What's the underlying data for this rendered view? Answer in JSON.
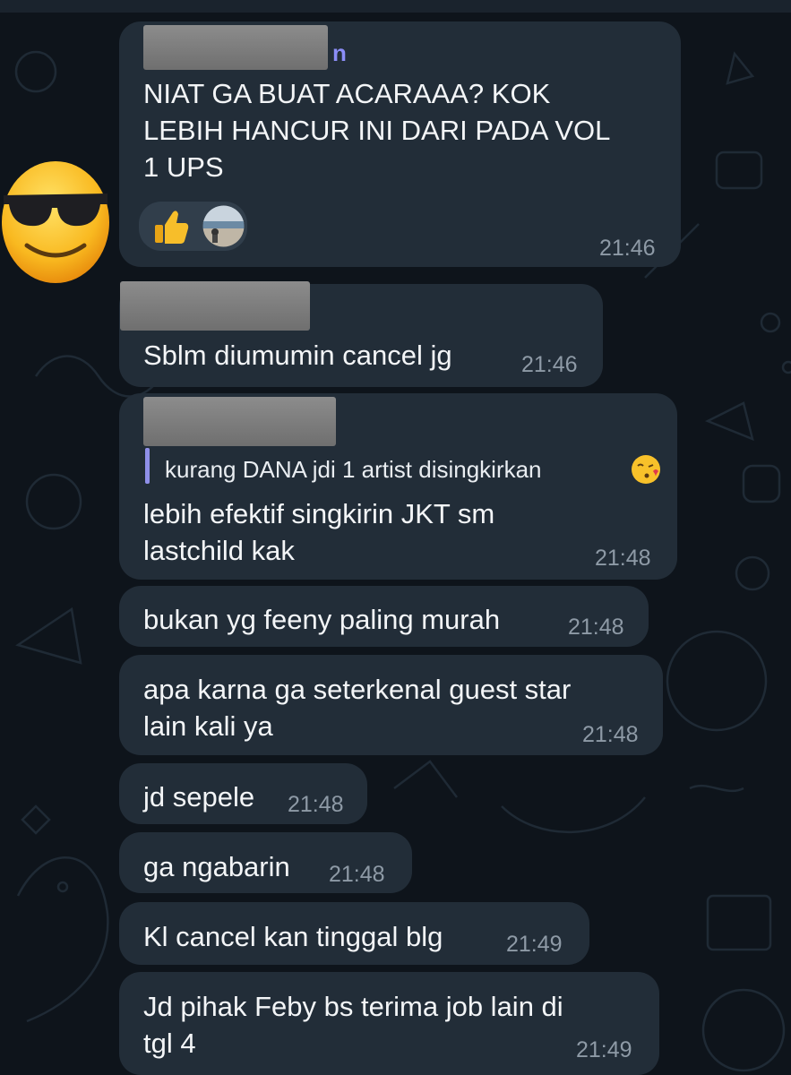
{
  "messages": [
    {
      "sender_suffix": "n",
      "text_lines": [
        "NIAT GA BUAT ACARAAA? KOK",
        "LEBIH HANCUR INI DARI PADA VOL",
        "1 UPS"
      ],
      "time": "21:46",
      "reaction_icon": "thumbs-up-emoji"
    },
    {
      "text_lines": [
        "Sblm diumumin cancel jg"
      ],
      "time": "21:46"
    },
    {
      "quote": "kurang DANA jdi 1 artist disingkirkan",
      "quote_icon": "kissing-face-emoji",
      "text_lines": [
        "lebih efektif singkirin JKT sm",
        "lastchild kak"
      ],
      "time": "21:48"
    },
    {
      "text_lines": [
        "bukan yg feeny paling murah"
      ],
      "time": "21:48"
    },
    {
      "text_lines": [
        "apa karna ga seterkenal guest star",
        "lain kali ya"
      ],
      "time": "21:48"
    },
    {
      "text_lines": [
        "jd sepele"
      ],
      "time": "21:48"
    },
    {
      "text_lines": [
        "ga ngabarin"
      ],
      "time": "21:48"
    },
    {
      "text_lines": [
        "Kl cancel kan tinggal blg"
      ],
      "time": "21:49"
    },
    {
      "text_lines": [
        "Jd pihak Feby bs terima job lain di",
        "tgl 4"
      ],
      "time": "21:49"
    }
  ],
  "colors": {
    "background": "#0e141b",
    "bubble": "#222d38",
    "sender_name": "#8b8df7",
    "timestamp": "#8e9aa6"
  },
  "icons": {
    "sender_avatar": "smiling-face-with-sunglasses-emoji",
    "reaction": "thumbs-up-emoji",
    "reactor_avatar": "beach-photo-avatar"
  }
}
